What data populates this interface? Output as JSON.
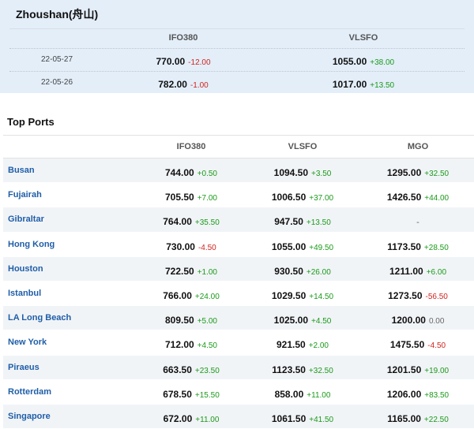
{
  "zhoushan": {
    "title": "Zhoushan(舟山)",
    "headers": [
      "IFO380",
      "VLSFO"
    ],
    "rows": [
      {
        "date": "22-05-27",
        "ifo380": {
          "price": "770.00",
          "change": "-12.00"
        },
        "vlsfo": {
          "price": "1055.00",
          "change": "+38.00"
        }
      },
      {
        "date": "22-05-26",
        "ifo380": {
          "price": "782.00",
          "change": "-1.00"
        },
        "vlsfo": {
          "price": "1017.00",
          "change": "+13.50"
        }
      }
    ]
  },
  "top_ports": {
    "title": "Top Ports",
    "headers": [
      "IFO380",
      "VLSFO",
      "MGO"
    ],
    "rows": [
      {
        "port": "Busan",
        "ifo380": {
          "price": "744.00",
          "change": "+0.50"
        },
        "vlsfo": {
          "price": "1094.50",
          "change": "+3.50"
        },
        "mgo": {
          "price": "1295.00",
          "change": "+32.50"
        }
      },
      {
        "port": "Fujairah",
        "ifo380": {
          "price": "705.50",
          "change": "+7.00"
        },
        "vlsfo": {
          "price": "1006.50",
          "change": "+37.00"
        },
        "mgo": {
          "price": "1426.50",
          "change": "+44.00"
        }
      },
      {
        "port": "Gibraltar",
        "ifo380": {
          "price": "764.00",
          "change": "+35.50"
        },
        "vlsfo": {
          "price": "947.50",
          "change": "+13.50"
        },
        "mgo": {
          "price": "-",
          "change": ""
        }
      },
      {
        "port": "Hong Kong",
        "ifo380": {
          "price": "730.00",
          "change": "-4.50"
        },
        "vlsfo": {
          "price": "1055.00",
          "change": "+49.50"
        },
        "mgo": {
          "price": "1173.50",
          "change": "+28.50"
        }
      },
      {
        "port": "Houston",
        "ifo380": {
          "price": "722.50",
          "change": "+1.00"
        },
        "vlsfo": {
          "price": "930.50",
          "change": "+26.00"
        },
        "mgo": {
          "price": "1211.00",
          "change": "+6.00"
        }
      },
      {
        "port": "Istanbul",
        "ifo380": {
          "price": "766.00",
          "change": "+24.00"
        },
        "vlsfo": {
          "price": "1029.50",
          "change": "+14.50"
        },
        "mgo": {
          "price": "1273.50",
          "change": "-56.50"
        }
      },
      {
        "port": "LA Long Beach",
        "ifo380": {
          "price": "809.50",
          "change": "+5.00"
        },
        "vlsfo": {
          "price": "1025.00",
          "change": "+4.50"
        },
        "mgo": {
          "price": "1200.00",
          "change": "0.00"
        }
      },
      {
        "port": "New York",
        "ifo380": {
          "price": "712.00",
          "change": "+4.50"
        },
        "vlsfo": {
          "price": "921.50",
          "change": "+2.00"
        },
        "mgo": {
          "price": "1475.50",
          "change": "-4.50"
        }
      },
      {
        "port": "Piraeus",
        "ifo380": {
          "price": "663.50",
          "change": "+23.50"
        },
        "vlsfo": {
          "price": "1123.50",
          "change": "+32.50"
        },
        "mgo": {
          "price": "1201.50",
          "change": "+19.00"
        }
      },
      {
        "port": "Rotterdam",
        "ifo380": {
          "price": "678.50",
          "change": "+15.50"
        },
        "vlsfo": {
          "price": "858.00",
          "change": "+11.00"
        },
        "mgo": {
          "price": "1206.00",
          "change": "+83.50"
        }
      },
      {
        "port": "Singapore",
        "ifo380": {
          "price": "672.00",
          "change": "+11.00"
        },
        "vlsfo": {
          "price": "1061.50",
          "change": "+41.50"
        },
        "mgo": {
          "price": "1165.00",
          "change": "+22.50"
        }
      }
    ]
  },
  "colors": {
    "up": "#1a9a1a",
    "down": "#d0251f",
    "flat": "#666666",
    "port_link": "#1f5ea8",
    "panel_bg": "#e3eef9"
  }
}
